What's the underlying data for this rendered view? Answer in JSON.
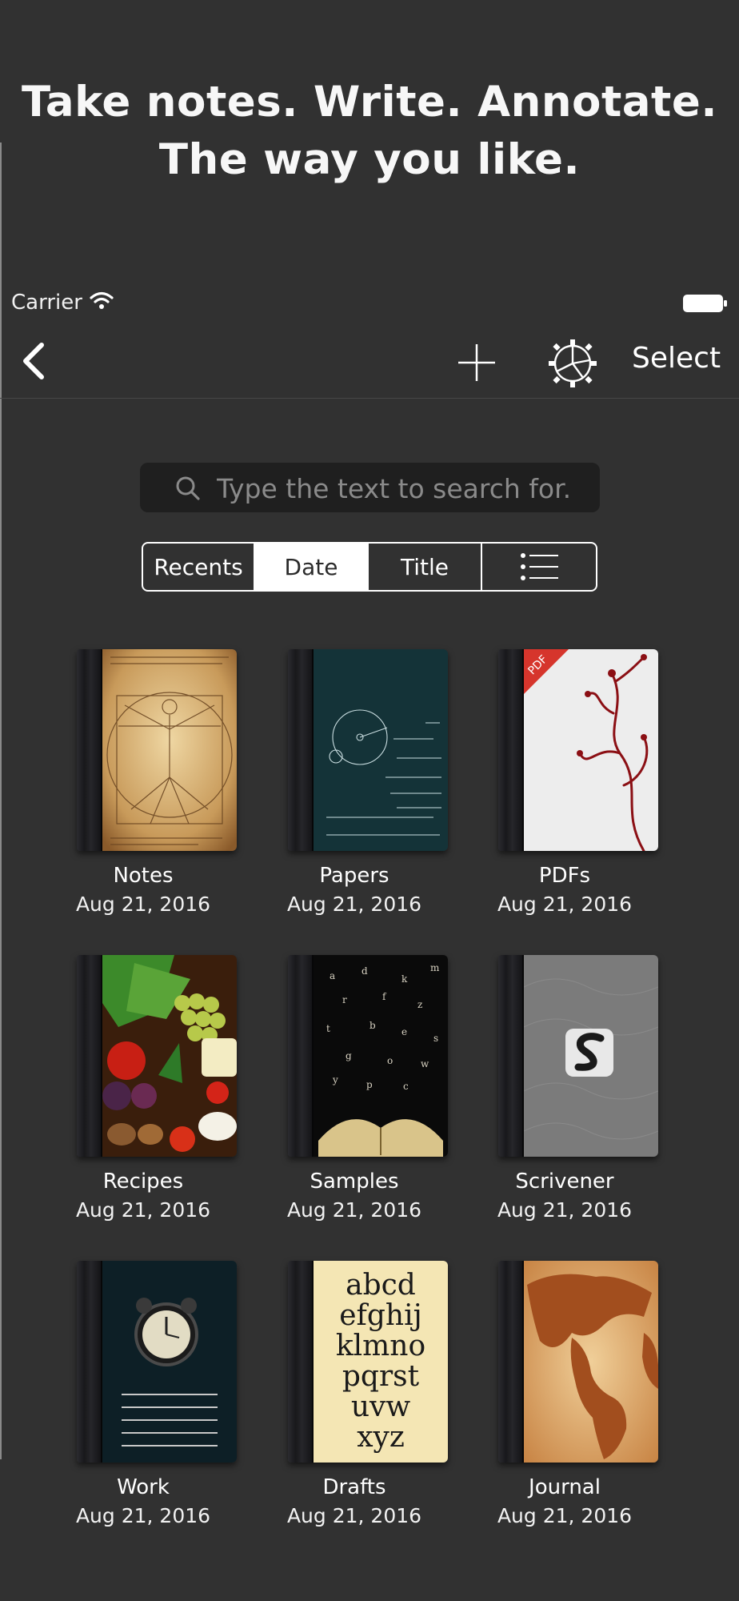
{
  "headline": {
    "line1": "Take notes. Write. Annotate.",
    "line2": "The way you like."
  },
  "status_bar": {
    "carrier": "Carrier"
  },
  "navbar": {
    "select_label": "Select",
    "back_icon": "chevron-left-icon",
    "add_icon": "plus-icon",
    "settings_icon": "gear-icon"
  },
  "search": {
    "placeholder": "Type the text to search for.",
    "value": ""
  },
  "sort_control": {
    "recents": "Recents",
    "date": "Date",
    "title": "Title",
    "list_icon": "list-icon",
    "selected": "Date"
  },
  "notebooks": [
    {
      "title": "Notes",
      "date": "Aug 21, 2016"
    },
    {
      "title": "Papers",
      "date": "Aug 21, 2016"
    },
    {
      "title": "PDFs",
      "date": "Aug 21, 2016",
      "badge": "PDF"
    },
    {
      "title": "Recipes",
      "date": "Aug 21, 2016"
    },
    {
      "title": "Samples",
      "date": "Aug 21, 2016"
    },
    {
      "title": "Scrivener",
      "date": "Aug 21, 2016"
    },
    {
      "title": "Work",
      "date": "Aug 21, 2016"
    },
    {
      "title": "Drafts",
      "date": "Aug 21, 2016",
      "cover_letters": "abcd efghij klmno pqrst uvw xyz"
    },
    {
      "title": "Journal",
      "date": "Aug 21, 2016"
    }
  ],
  "colors": {
    "background": "#313131",
    "search_background": "#1f1f1f",
    "segment_selected": "#ffffff"
  }
}
